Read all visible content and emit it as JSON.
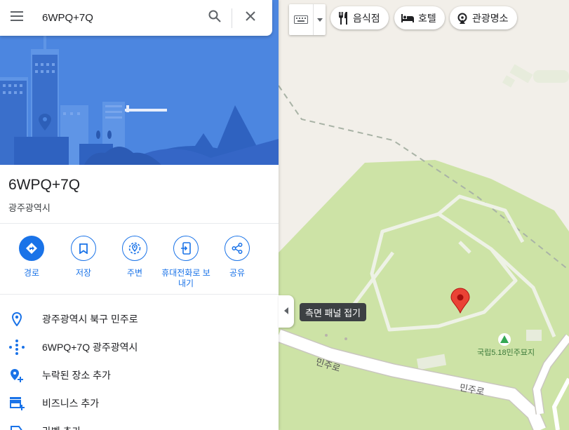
{
  "search": {
    "value": "6WPQ+7Q",
    "placeholder": ""
  },
  "place": {
    "title": "6WPQ+7Q",
    "subtitle": "광주광역시"
  },
  "actions": [
    {
      "label": "경로",
      "icon": "directions-icon"
    },
    {
      "label": "저장",
      "icon": "bookmark-icon"
    },
    {
      "label": "주변",
      "icon": "nearby-icon"
    },
    {
      "label": "휴대전화로 보내기",
      "icon": "send-to-phone-icon"
    },
    {
      "label": "공유",
      "icon": "share-icon"
    }
  ],
  "info": [
    {
      "text": "광주광역시 북구 민주로",
      "icon": "location-pin-icon"
    },
    {
      "text": "6WPQ+7Q 광주광역시",
      "icon": "plus-code-icon"
    },
    {
      "text": "누락된 장소 추가",
      "icon": "add-place-icon"
    },
    {
      "text": "비즈니스 추가",
      "icon": "add-business-icon"
    },
    {
      "text": "라벨 추가",
      "icon": "add-label-icon"
    }
  ],
  "collapse_tooltip": "측면 패널 접기",
  "chips": [
    {
      "label": "음식점",
      "icon": "restaurant-icon"
    },
    {
      "label": "호텔",
      "icon": "hotel-icon"
    },
    {
      "label": "관광명소",
      "icon": "attraction-icon"
    }
  ],
  "map": {
    "road_label_1": "민주로",
    "road_label_2": "민주로",
    "poi_label": "국립5.18민주묘지"
  },
  "colors": {
    "accent": "#1a73e8",
    "marker": "#ea4335",
    "park": "#cde3a6",
    "hero": "#4c86e0"
  }
}
